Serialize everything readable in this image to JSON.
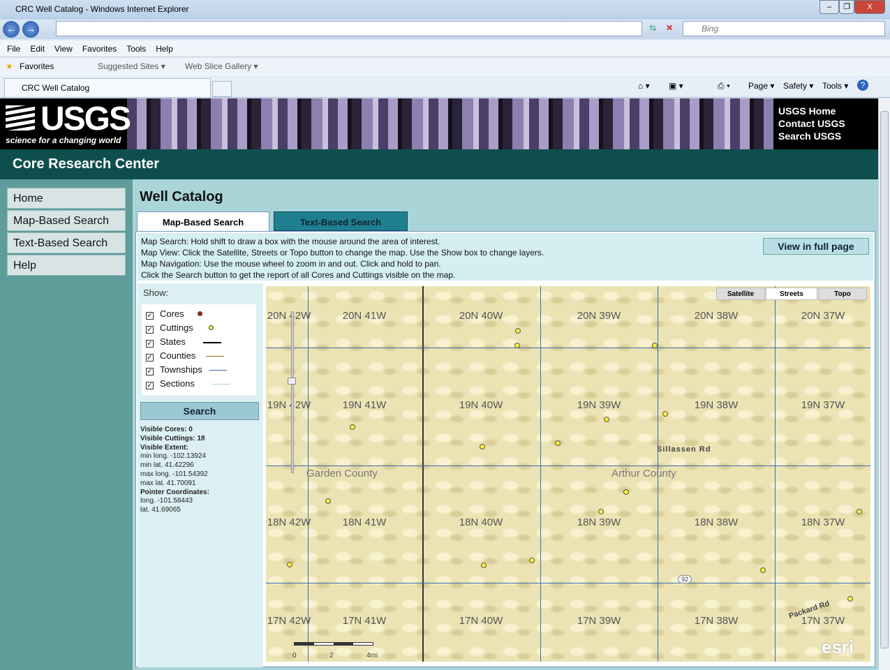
{
  "window": {
    "title": "CRC Well Catalog - Windows Internet Explorer",
    "minimize": "–",
    "restore": "❐",
    "close": "X"
  },
  "address": {
    "url": "",
    "search_placeholder": "Bing"
  },
  "menu": [
    "File",
    "Edit",
    "View",
    "Favorites",
    "Tools",
    "Help"
  ],
  "favorites": {
    "label": "Favorites",
    "suggested": "Suggested Sites ▾",
    "webslice": "Web Slice Gallery ▾"
  },
  "tab": {
    "label": "CRC Well Catalog"
  },
  "commandbar": {
    "page": "Page ▾",
    "safety": "Safety ▾",
    "tools": "Tools ▾",
    "help": "?"
  },
  "banner": {
    "logo": "USGS",
    "tagline": "science for a changing world",
    "links": [
      "USGS Home",
      "Contact USGS",
      "Search USGS"
    ]
  },
  "site_title": "Core Research Center",
  "sidebar": [
    "Home",
    "Map-Based Search",
    "Text-Based Search",
    "Help"
  ],
  "main": {
    "title": "Well Catalog",
    "tabs": [
      {
        "label": "Map-Based Search",
        "active": true
      },
      {
        "label": "Text-Based Search",
        "active": false
      }
    ],
    "instructions": [
      "Map Search: Hold shift to draw a box with the mouse around the area of interest.",
      "Map View: Click the Satellite, Streets or Topo button to change the map. Use the Show box to change layers.",
      "Map Navigation: Use the mouse wheel to zoom in and out. Click and hold to pan.",
      "Click the Search button to get the report of all Cores and Cuttings visible on the map."
    ],
    "full_page_button": "View in full page"
  },
  "layers": {
    "show_label": "Show:",
    "items": [
      {
        "label": "Cores",
        "checked": true,
        "color": "#c0141c"
      },
      {
        "label": "Cuttings",
        "checked": true,
        "color": "#ffef3a"
      },
      {
        "label": "States",
        "checked": true,
        "color": "#000000"
      },
      {
        "label": "Counties",
        "checked": true,
        "color": "#8a6d1a"
      },
      {
        "label": "Townships",
        "checked": true,
        "color": "#3b6fb2"
      },
      {
        "label": "Sections",
        "checked": true,
        "color": "#a9d4e0"
      }
    ]
  },
  "search_button": "Search",
  "stats": {
    "cores_label": "Visible Cores:",
    "cores": "0",
    "cuttings_label": "Visible Cuttings:",
    "cuttings": "18",
    "extent_label": "Visible Extent:",
    "min_long": "min long. -102.13924",
    "min_lat": "min lat. 41.42296",
    "max_long": "max long. -101.54392",
    "max_lat": "max lat. 41.70091",
    "pointer_label": "Pointer Coordinates:",
    "pointer_long": "long. -101.58443",
    "pointer_lat": "lat. 41.69065"
  },
  "map": {
    "basemap_buttons": [
      {
        "label": "Satellite",
        "active": false
      },
      {
        "label": "Streets",
        "active": true
      },
      {
        "label": "Topo",
        "active": false
      }
    ],
    "townships": [
      [
        "20N 42W",
        "20N 41W",
        "20N 40W",
        "20N 39W",
        "20N 38W",
        "20N 37W"
      ],
      [
        "19N 42W",
        "19N 41W",
        "19N 40W",
        "19N 39W",
        "19N 38W",
        "19N 37W"
      ],
      [
        "18N 42W",
        "18N 41W",
        "18N 40W",
        "18N 39W",
        "18N 38W",
        "18N 37W"
      ],
      [
        "17N 42W",
        "17N 41W",
        "17N 40W",
        "17N 39W",
        "17N 38W",
        "17N 37W"
      ]
    ],
    "counties": [
      "Garden County",
      "Arthur County"
    ],
    "roads": [
      "Sillassen Rd",
      "Packard Rd",
      "92"
    ],
    "scale_ticks": [
      "0",
      "2",
      "4mi"
    ],
    "attribution": "esri"
  }
}
